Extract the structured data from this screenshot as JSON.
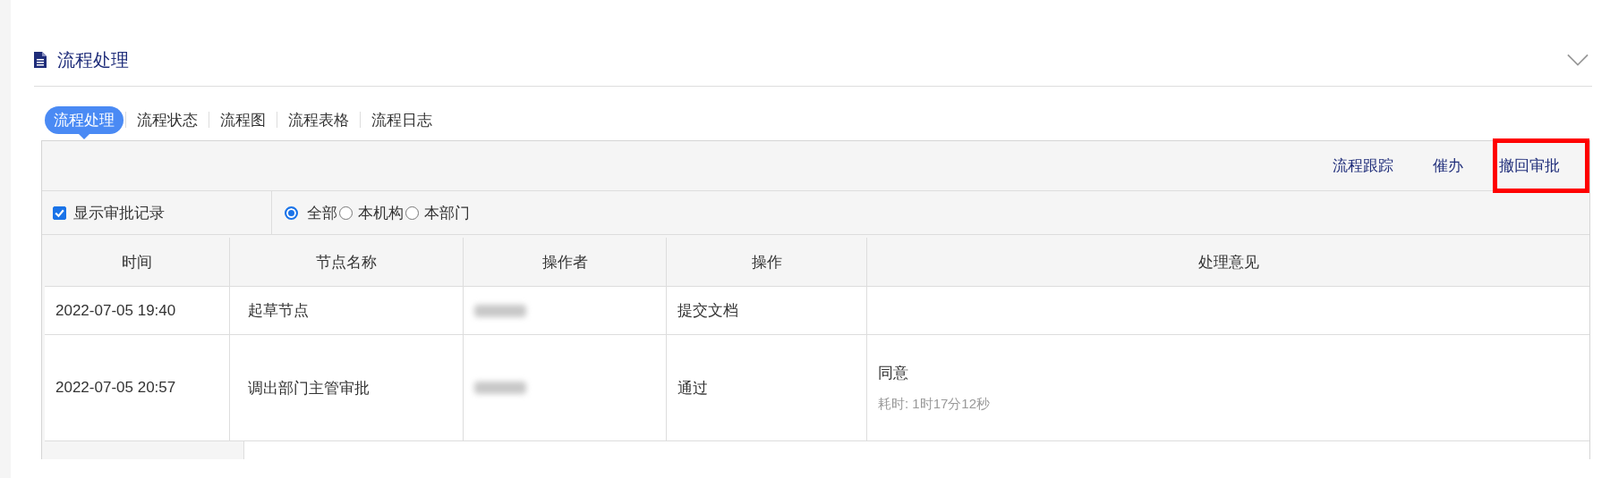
{
  "section": {
    "title": "流程处理",
    "expanded": true
  },
  "tabs": [
    {
      "label": "流程处理",
      "selected": true
    },
    {
      "label": "流程状态",
      "selected": false
    },
    {
      "label": "流程图",
      "selected": false
    },
    {
      "label": "流程表格",
      "selected": false
    },
    {
      "label": "流程日志",
      "selected": false
    }
  ],
  "actions": [
    {
      "label": "流程跟踪",
      "highlighted": false
    },
    {
      "label": "催办",
      "highlighted": false
    },
    {
      "label": "撤回审批",
      "highlighted": true
    }
  ],
  "filter": {
    "show_records": {
      "label": "显示审批记录",
      "checked": true
    },
    "scope": [
      {
        "label": "全部",
        "selected": true
      },
      {
        "label": "本机构",
        "selected": false
      },
      {
        "label": "本部门",
        "selected": false
      }
    ]
  },
  "table": {
    "columns": [
      "时间",
      "节点名称",
      "操作者",
      "操作",
      "处理意见"
    ],
    "rows": [
      {
        "time": "2022-07-05 19:40",
        "node": "起草节点",
        "operator_blurred": true,
        "action": "提交文档",
        "comments": []
      },
      {
        "time": "2022-07-05 20:57",
        "node": "调出部门主管审批",
        "operator_blurred": true,
        "action": "通过",
        "comments": [
          {
            "kind": "opinion",
            "text": "同意"
          },
          {
            "kind": "duration",
            "text": "耗时: 1时17分12秒"
          }
        ]
      }
    ]
  }
}
